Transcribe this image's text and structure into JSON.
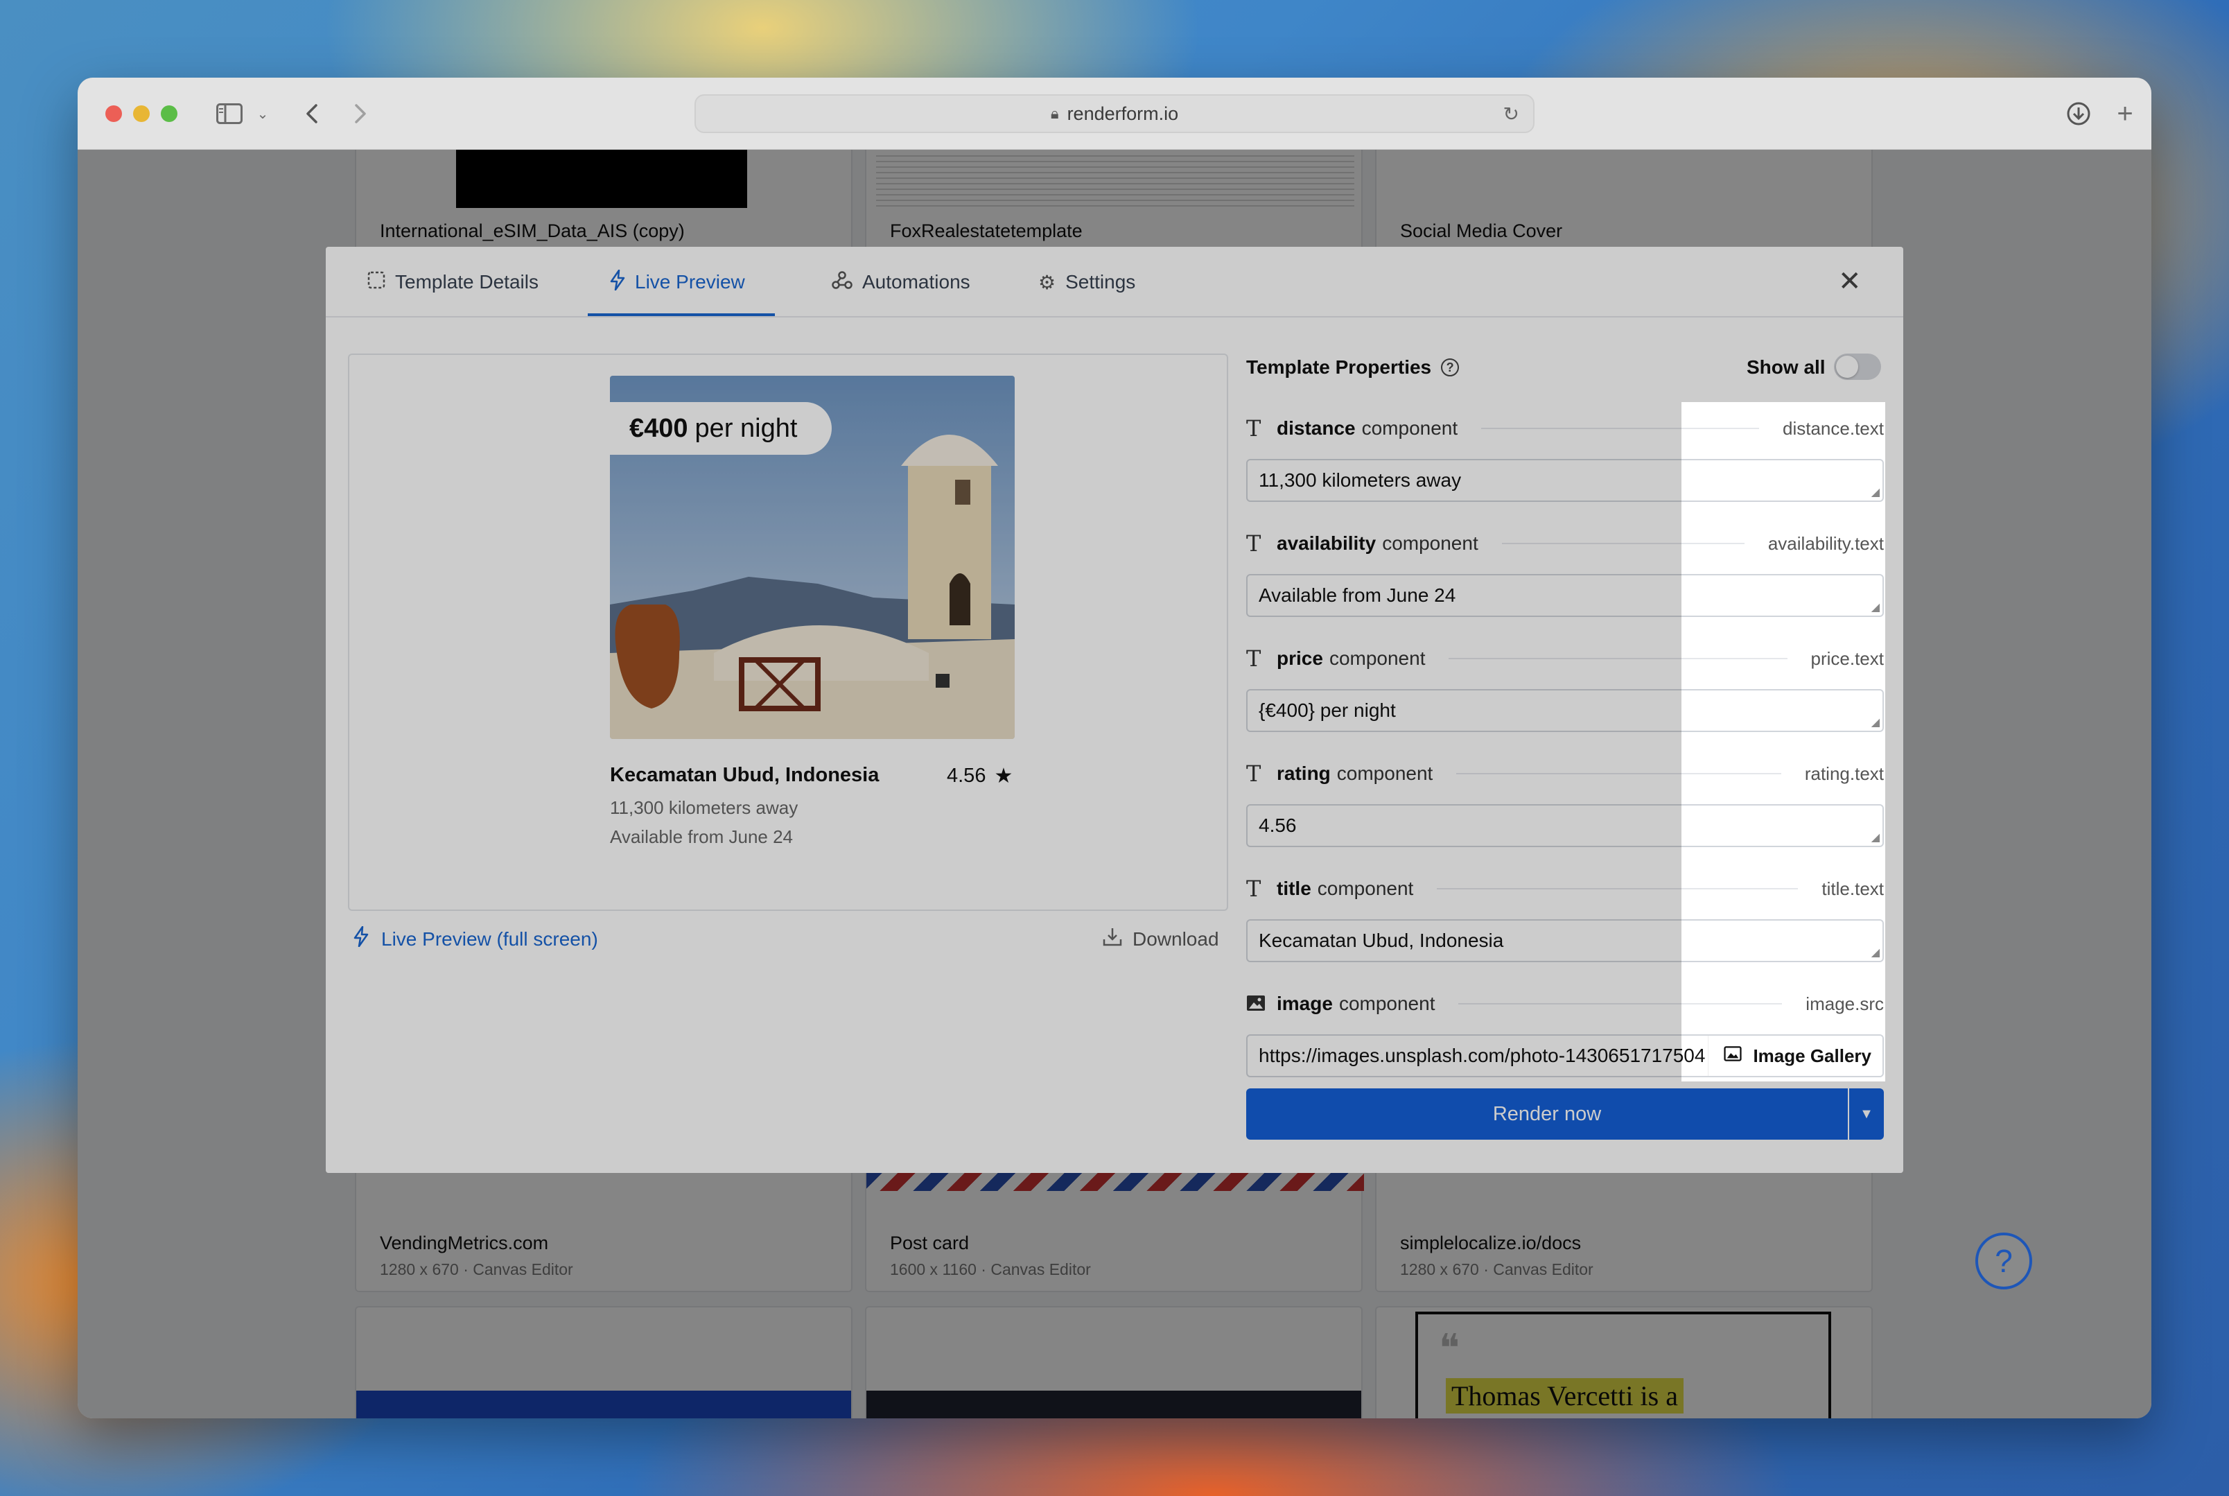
{
  "browser": {
    "url": "renderform.io"
  },
  "background_cards": {
    "row1": [
      {
        "name": "International_eSIM_Data_AIS (copy)"
      },
      {
        "name": "FoxRealestatetemplate"
      },
      {
        "name": "Social Media Cover"
      }
    ],
    "row2": [
      {
        "name": "VendingMetrics.com",
        "meta": "1280 x 670  ·  Canvas Editor"
      },
      {
        "name": "Post card",
        "meta": "1600 x 1160  ·  Canvas Editor"
      },
      {
        "name": "simplelocalize.io/docs",
        "meta": "1280 x 670  ·  Canvas Editor"
      }
    ],
    "quote_text": "Thomas Vercetti is a"
  },
  "modal": {
    "tabs": [
      {
        "label": "Template Details",
        "icon": "dashed-square-icon"
      },
      {
        "label": "Live Preview",
        "icon": "lightning-icon"
      },
      {
        "label": "Automations",
        "icon": "webhook-icon"
      },
      {
        "label": "Settings",
        "icon": "gear-icon"
      }
    ],
    "active_tab": "Live Preview",
    "preview": {
      "price_bold": "€400",
      "price_rest": "per night",
      "title": "Kecamatan Ubud, Indonesia",
      "rating": "4.56",
      "distance": "11,300 kilometers away",
      "availability": "Available from June 24"
    },
    "live_preview_link": "Live Preview (full screen)",
    "download_label": "Download",
    "properties": {
      "heading": "Template Properties",
      "show_all_label": "Show all",
      "show_all_enabled": false,
      "component_word": "component",
      "items": [
        {
          "name": "distance",
          "key": "distance.text",
          "value": "11,300 kilometers away",
          "type": "text"
        },
        {
          "name": "availability",
          "key": "availability.text",
          "value": "Available from June 24",
          "type": "text"
        },
        {
          "name": "price",
          "key": "price.text",
          "value": "{€400} per night",
          "type": "text"
        },
        {
          "name": "rating",
          "key": "rating.text",
          "value": "4.56",
          "type": "text"
        },
        {
          "name": "title",
          "key": "title.text",
          "value": "Kecamatan Ubud, Indonesia",
          "type": "text"
        },
        {
          "name": "image",
          "key": "image.src",
          "value": "https://images.unsplash.com/photo-1430651717504",
          "type": "image"
        }
      ],
      "image_gallery_label": "Image Gallery"
    },
    "render_label": "Render now"
  },
  "colors": {
    "accent": "#1560d8",
    "link": "#1a66d0"
  }
}
